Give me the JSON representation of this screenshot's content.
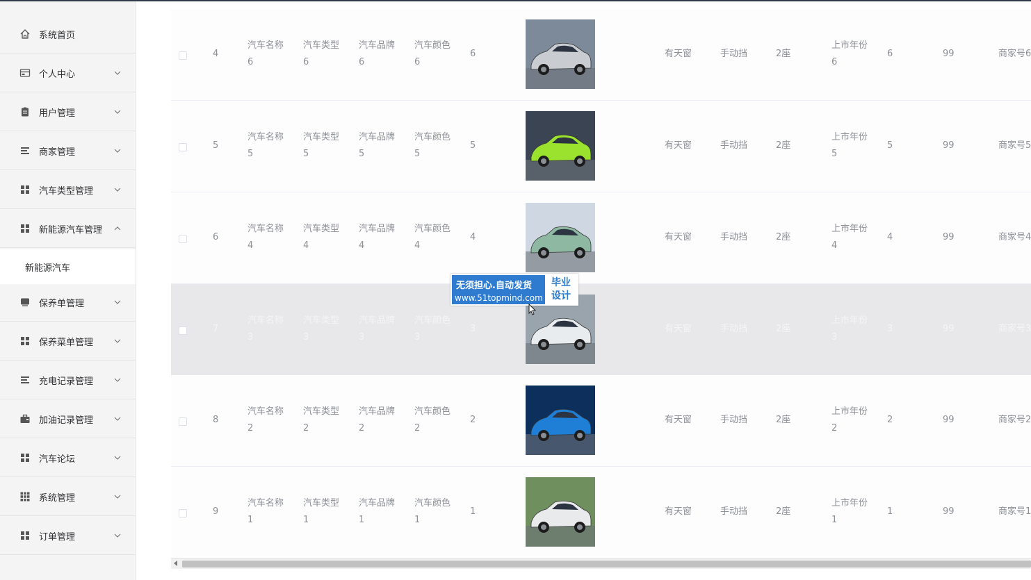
{
  "sidebar": {
    "items": [
      {
        "label": "系统首页",
        "icon": "home-icon"
      },
      {
        "label": "个人中心",
        "icon": "card-icon"
      },
      {
        "label": "用户管理",
        "icon": "clipboard-icon"
      },
      {
        "label": "商家管理",
        "icon": "list-icon"
      },
      {
        "label": "汽车类型管理",
        "icon": "grid-icon"
      },
      {
        "label": "新能源汽车管理",
        "icon": "grid-icon"
      },
      {
        "label": "保养单管理",
        "icon": "monitor-icon"
      },
      {
        "label": "保养菜单管理",
        "icon": "grid-icon"
      },
      {
        "label": "充电记录管理",
        "icon": "list-icon"
      },
      {
        "label": "加油记录管理",
        "icon": "briefcase-icon"
      },
      {
        "label": "汽车论坛",
        "icon": "grid-icon"
      },
      {
        "label": "系统管理",
        "icon": "apps-icon"
      },
      {
        "label": "订单管理",
        "icon": "grid-icon"
      }
    ],
    "active_sub": "新能源汽车"
  },
  "table": {
    "rows": [
      {
        "index": "4",
        "name": [
          "汽车名称",
          "6"
        ],
        "type": [
          "汽车类型",
          "6"
        ],
        "brand": [
          "汽车品牌",
          "6"
        ],
        "color": [
          "汽车颜色",
          "6"
        ],
        "num": "6",
        "sunroof": "有天窗",
        "gearbox": "手动挡",
        "seats": "2座",
        "year": [
          "上市年份",
          "6"
        ],
        "num2": "6",
        "price": "99",
        "merchant": "商家号6"
      },
      {
        "index": "5",
        "name": [
          "汽车名称",
          "5"
        ],
        "type": [
          "汽车类型",
          "5"
        ],
        "brand": [
          "汽车品牌",
          "5"
        ],
        "color": [
          "汽车颜色",
          "5"
        ],
        "num": "5",
        "sunroof": "有天窗",
        "gearbox": "手动挡",
        "seats": "2座",
        "year": [
          "上市年份",
          "5"
        ],
        "num2": "5",
        "price": "99",
        "merchant": "商家号5"
      },
      {
        "index": "6",
        "name": [
          "汽车名称",
          "4"
        ],
        "type": [
          "汽车类型",
          "4"
        ],
        "brand": [
          "汽车品牌",
          "4"
        ],
        "color": [
          "汽车颜色",
          "4"
        ],
        "num": "4",
        "sunroof": "有天窗",
        "gearbox": "手动挡",
        "seats": "2座",
        "year": [
          "上市年份",
          "4"
        ],
        "num2": "4",
        "price": "99",
        "merchant": "商家号4"
      },
      {
        "index": "7",
        "name": [
          "汽车名称",
          "3"
        ],
        "type": [
          "汽车类型",
          "3"
        ],
        "brand": [
          "汽车品牌",
          "3"
        ],
        "color": [
          "汽车颜色",
          "3"
        ],
        "num": "3",
        "sunroof": "有天窗",
        "gearbox": "手动挡",
        "seats": "2座",
        "year": [
          "上市年份",
          "3"
        ],
        "num2": "3",
        "price": "99",
        "merchant": "商家号3"
      },
      {
        "index": "8",
        "name": [
          "汽车名称",
          "2"
        ],
        "type": [
          "汽车类型",
          "2"
        ],
        "brand": [
          "汽车品牌",
          "2"
        ],
        "color": [
          "汽车颜色",
          "2"
        ],
        "num": "2",
        "sunroof": "有天窗",
        "gearbox": "手动挡",
        "seats": "2座",
        "year": [
          "上市年份",
          "2"
        ],
        "num2": "2",
        "price": "99",
        "merchant": "商家号2"
      },
      {
        "index": "9",
        "name": [
          "汽车名称",
          "1"
        ],
        "type": [
          "汽车类型",
          "1"
        ],
        "brand": [
          "汽车品牌",
          "1"
        ],
        "color": [
          "汽车颜色",
          "1"
        ],
        "num": "1",
        "sunroof": "有天窗",
        "gearbox": "手动挡",
        "seats": "2座",
        "year": [
          "上市年份",
          "1"
        ],
        "num2": "1",
        "price": "99",
        "merchant": "商家号1"
      }
    ],
    "car_colors": [
      "#c9ccd1",
      "#9be22e",
      "#8fb8a2",
      "#e9ecef",
      "#1f7fd6",
      "#e8eaec"
    ],
    "thumb_backgrounds": [
      "#7d8a99",
      "#3b4452",
      "#cfd8e2",
      "#9aa4ad",
      "#0d2f5c",
      "#6f8f5f"
    ]
  },
  "watermark": {
    "line1": "无须担心.自动发货",
    "line2": "www.51topmind.com",
    "side1": "毕业",
    "side2": "设计"
  }
}
